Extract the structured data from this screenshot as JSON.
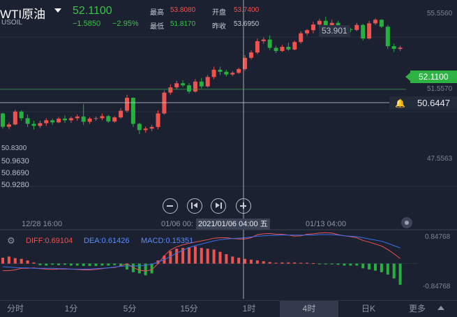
{
  "header": {
    "symbol_name": "WTI原油",
    "symbol_code": "USOIL",
    "last_price": "52.1100",
    "change": "−1.5850",
    "change_pct": "−2.95%",
    "high_label": "最高",
    "high_value": "53.8080",
    "low_label": "最低",
    "low_value": "51.8170",
    "open_label": "开盘",
    "open_value": "53.7400",
    "prev_close_label": "昨收",
    "prev_close_value": "53.6950"
  },
  "price_axis": {
    "ticks": [
      "55.5560",
      "51.5570",
      "47.5563"
    ],
    "peak_marker": "53.901",
    "last_price_tag": "52.1100",
    "alert_price": "50.6447"
  },
  "legend_values": [
    "50.8300",
    "50.9630",
    "50.8690",
    "50.9280"
  ],
  "time_axis": {
    "labels": [
      "12/28 16:00",
      "01/06 00:",
      "01/13 04:00"
    ],
    "crosshair_label": "2021/01/06 04:00 五"
  },
  "macd": {
    "diff_label": "DIFF:0.69104",
    "dea_label": "DEA:0.61426",
    "macd_label": "MACD:0.15351",
    "axis_top": "0.84768",
    "axis_bottom": "-0.84768"
  },
  "timeframes": [
    "分时",
    "1分",
    "5分",
    "15分",
    "1时",
    "4时",
    "日K",
    "更多"
  ],
  "active_timeframe": "4时",
  "colors": {
    "background": "#1b2130",
    "up": "#ef5350",
    "down": "#26b040",
    "price_green": "#3cc24a",
    "diff_line": "#ef5350",
    "dea_line": "#3a6ff0",
    "macd_text": "#5b8cff"
  },
  "chart_data": {
    "type": "candlestick",
    "series": [
      {
        "name": "price",
        "ohlc": [
          [
            50.95,
            50.98,
            50.22,
            50.31
          ],
          [
            50.31,
            50.52,
            50.2,
            50.42
          ],
          [
            50.42,
            51.12,
            50.38,
            51.04
          ],
          [
            51.04,
            51.1,
            50.6,
            50.72
          ],
          [
            50.72,
            50.9,
            50.3,
            50.45
          ],
          [
            50.45,
            50.6,
            50.18,
            50.35
          ],
          [
            50.35,
            50.6,
            50.25,
            50.48
          ],
          [
            50.48,
            50.72,
            50.35,
            50.62
          ],
          [
            50.62,
            50.7,
            50.4,
            50.52
          ],
          [
            50.52,
            50.78,
            50.48,
            50.7
          ],
          [
            50.7,
            50.85,
            50.5,
            50.62
          ],
          [
            50.62,
            50.8,
            50.5,
            50.72
          ],
          [
            50.72,
            50.9,
            50.6,
            50.8
          ],
          [
            50.8,
            51.4,
            50.4,
            50.55
          ],
          [
            50.55,
            50.78,
            50.45,
            50.7
          ],
          [
            50.7,
            50.8,
            50.6,
            50.72
          ],
          [
            50.72,
            50.95,
            50.62,
            50.82
          ],
          [
            50.82,
            50.88,
            50.5,
            50.56
          ],
          [
            50.56,
            50.82,
            50.5,
            50.76
          ],
          [
            50.76,
            51.2,
            50.7,
            51.08
          ],
          [
            51.08,
            51.85,
            51.0,
            51.7
          ],
          [
            51.7,
            51.72,
            50.3,
            50.45
          ],
          [
            50.45,
            50.5,
            49.95,
            50.15
          ],
          [
            50.15,
            50.32,
            50.02,
            50.22
          ],
          [
            50.22,
            50.4,
            50.1,
            50.3
          ],
          [
            50.3,
            51.1,
            50.18,
            50.95
          ],
          [
            50.95,
            52.05,
            50.9,
            51.95
          ],
          [
            51.95,
            52.35,
            51.85,
            52.2
          ],
          [
            52.2,
            52.52,
            52.1,
            52.4
          ],
          [
            52.4,
            52.55,
            52.22,
            52.3
          ],
          [
            52.3,
            52.4,
            51.9,
            52.0
          ],
          [
            52.0,
            52.6,
            51.95,
            52.48
          ],
          [
            52.48,
            52.65,
            52.15,
            52.25
          ],
          [
            52.25,
            52.8,
            52.2,
            52.7
          ],
          [
            52.7,
            53.2,
            52.6,
            53.05
          ],
          [
            53.05,
            53.2,
            52.8,
            52.95
          ],
          [
            52.95,
            53.05,
            52.72,
            52.82
          ],
          [
            52.82,
            52.98,
            52.75,
            52.9
          ],
          [
            52.9,
            53.15,
            52.85,
            53.08
          ],
          [
            53.08,
            53.75,
            53.0,
            53.62
          ],
          [
            53.62,
            53.98,
            53.55,
            53.88
          ],
          [
            53.88,
            54.55,
            53.8,
            54.42
          ],
          [
            54.42,
            54.6,
            54.3,
            54.5
          ],
          [
            54.5,
            54.7,
            54.0,
            54.1
          ],
          [
            54.1,
            54.2,
            53.85,
            53.95
          ],
          [
            53.95,
            54.25,
            53.9,
            54.15
          ],
          [
            54.15,
            54.35,
            53.95,
            54.02
          ],
          [
            54.02,
            54.45,
            53.98,
            54.38
          ],
          [
            54.38,
            54.9,
            54.3,
            54.8
          ],
          [
            54.8,
            55.0,
            54.7,
            54.95
          ],
          [
            54.95,
            55.35,
            54.8,
            55.22
          ],
          [
            55.22,
            55.5,
            55.1,
            55.4
          ],
          [
            55.4,
            55.6,
            55.05,
            55.1
          ],
          [
            55.1,
            55.45,
            54.95,
            55.3
          ],
          [
            55.3,
            55.4,
            54.7,
            54.78
          ],
          [
            54.78,
            55.1,
            54.7,
            55.0
          ],
          [
            55.0,
            55.05,
            54.85,
            54.96
          ],
          [
            54.96,
            55.3,
            54.9,
            55.2
          ],
          [
            55.2,
            55.25,
            54.45,
            54.55
          ],
          [
            54.55,
            55.4,
            54.5,
            55.28
          ],
          [
            55.28,
            55.52,
            55.2,
            55.45
          ],
          [
            55.45,
            55.48,
            55.05,
            55.12
          ],
          [
            55.12,
            55.2,
            54.05,
            54.18
          ],
          [
            54.18,
            54.3,
            53.9,
            54.05
          ],
          [
            54.05,
            54.2,
            53.95,
            54.11
          ]
        ]
      },
      {
        "name": "DIFF",
        "values": [
          -0.18,
          -0.18,
          -0.16,
          -0.12,
          -0.12,
          -0.11,
          -0.13,
          -0.14,
          -0.15,
          -0.14,
          -0.14,
          -0.14,
          -0.15,
          -0.16,
          -0.16,
          -0.15,
          -0.13,
          -0.11,
          -0.1,
          -0.06,
          0.0,
          -0.1,
          -0.17,
          -0.19,
          -0.16,
          0.0,
          0.2,
          0.35,
          0.43,
          0.48,
          0.52,
          0.55,
          0.58,
          0.61,
          0.65,
          0.66,
          0.66,
          0.64,
          0.63,
          0.63,
          0.66,
          0.74,
          0.76,
          0.77,
          0.75,
          0.75,
          0.73,
          0.7,
          0.71,
          0.75,
          0.76,
          0.78,
          0.79,
          0.78,
          0.74,
          0.71,
          0.69,
          0.66,
          0.59,
          0.55,
          0.5,
          0.45,
          0.36,
          0.25,
          0.13
        ]
      },
      {
        "name": "DEA",
        "values": [
          -0.08,
          -0.09,
          -0.1,
          -0.11,
          -0.11,
          -0.12,
          -0.12,
          -0.12,
          -0.12,
          -0.13,
          -0.13,
          -0.14,
          -0.14,
          -0.14,
          -0.14,
          -0.13,
          -0.12,
          -0.11,
          -0.09,
          -0.07,
          -0.06,
          -0.06,
          -0.06,
          -0.04,
          -0.02,
          0.04,
          0.1,
          0.18,
          0.27,
          0.34,
          0.41,
          0.46,
          0.5,
          0.54,
          0.58,
          0.61,
          0.63,
          0.64,
          0.65,
          0.66,
          0.68,
          0.7,
          0.71,
          0.72,
          0.72,
          0.73,
          0.73,
          0.73,
          0.73,
          0.73,
          0.73,
          0.74,
          0.74,
          0.74,
          0.73,
          0.71,
          0.7,
          0.69,
          0.66,
          0.63,
          0.6,
          0.57,
          0.52,
          0.46,
          0.4
        ]
      },
      {
        "name": "MACD",
        "values": [
          0.15,
          0.18,
          0.14,
          0.12,
          0.08,
          0.03,
          -0.04,
          -0.05,
          -0.03,
          -0.04,
          -0.03,
          -0.05,
          -0.05,
          -0.06,
          -0.06,
          -0.06,
          -0.05,
          -0.05,
          -0.04,
          -0.07,
          -0.15,
          -0.22,
          -0.25,
          -0.3,
          -0.25,
          0.08,
          0.2,
          0.32,
          0.38,
          0.4,
          0.42,
          0.44,
          0.4,
          0.38,
          0.36,
          0.3,
          0.24,
          0.18,
          0.15,
          0.12,
          0.1,
          0.08,
          0.06,
          0.04,
          0.02,
          0.03,
          0.03,
          0.03,
          0.02,
          0.02,
          0.01,
          -0.02,
          -0.02,
          -0.02,
          -0.03,
          -0.05,
          -0.05,
          -0.05,
          -0.12,
          -0.15,
          -0.18,
          -0.22,
          -0.28,
          -0.38,
          -0.54
        ]
      }
    ],
    "y_range": [
      46.0,
      56.4
    ],
    "macd_range": [
      -0.84768,
      0.84768
    ]
  }
}
